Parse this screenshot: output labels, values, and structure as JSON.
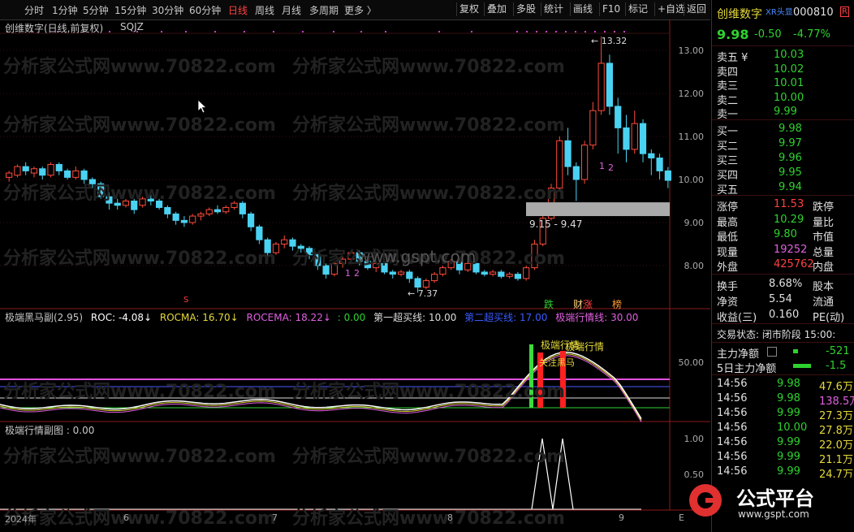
{
  "toolbar": {
    "periods": [
      "分时",
      "1分钟",
      "5分钟",
      "15分钟",
      "30分钟",
      "60分钟",
      "日线",
      "周线",
      "月线",
      "多周期",
      "更多 〉"
    ],
    "active_period": "日线",
    "buttons": [
      "复权",
      "叠加",
      "多股",
      "统计",
      "画线",
      "F10",
      "标记",
      "+自选",
      "返回"
    ]
  },
  "chart": {
    "title": "创维数字(日线,前复权)",
    "indicator": "SQJZ",
    "price_ticks": [
      "13.00",
      "12.00",
      "11.00",
      "10.00",
      "9.00",
      "8.00"
    ],
    "high_label": "13.32",
    "low_label": "7.37",
    "range_label": "9.15 - 9.47",
    "markers": [
      "跌",
      "财",
      "涨",
      "榜"
    ],
    "s_marker": "S",
    "num_labels": [
      "1",
      "2",
      "1",
      "2"
    ],
    "sub1": {
      "name": "极端黑马副(2.95)",
      "roc": "ROC: -4.08",
      "rocma": "ROCMA: 16.70",
      "rocema": "ROCEMA: 18.22",
      "zero": ": 0.00",
      "line1": "第一超买线: 10.00",
      "line2": "第二超买线: 17.00",
      "line3": "极端行情线: 30.00",
      "tick": "50.00",
      "annot1": "极端行情",
      "annot2": "极端行情",
      "annot3": "关注黑马"
    },
    "sub2": {
      "name": "极端行情副图 : 0.00",
      "ticks": [
        "1.00",
        "0.50"
      ]
    },
    "dates": [
      "2024年",
      "6",
      "7",
      "8",
      "9"
    ],
    "date_tail": "E"
  },
  "watermark": "分析家公式网www.70822.com",
  "quote": {
    "name": "创维数字",
    "tag": "XR头显",
    "code": "000810",
    "r_badge": "R",
    "price": "9.98",
    "change": "-0.50",
    "pct": "-4.77%",
    "asks": [
      {
        "label": "卖五 ¥",
        "price": "10.03"
      },
      {
        "label": "卖四",
        "price": "10.02"
      },
      {
        "label": "卖三",
        "price": "10.01"
      },
      {
        "label": "卖二",
        "price": "10.00"
      },
      {
        "label": "卖一",
        "price": "9.99"
      }
    ],
    "bids": [
      {
        "label": "买一",
        "price": "9.98"
      },
      {
        "label": "买二",
        "price": "9.97"
      },
      {
        "label": "买三",
        "price": "9.96"
      },
      {
        "label": "买四",
        "price": "9.95"
      },
      {
        "label": "买五",
        "price": "9.94"
      }
    ],
    "stats": [
      {
        "l": "涨停",
        "v": "11.53",
        "r": "跌停"
      },
      {
        "l": "最高",
        "v": "10.29",
        "r": "量比"
      },
      {
        "l": "最低",
        "v": "9.80",
        "r": "市值"
      },
      {
        "l": "现量",
        "v": "19252",
        "r": "总量"
      },
      {
        "l": "外盘",
        "v": "425762",
        "r": "内盘"
      }
    ],
    "stats2": [
      {
        "l": "换手",
        "v": "8.68%",
        "r": "股本"
      },
      {
        "l": "净资",
        "v": "5.54",
        "r": "流通"
      },
      {
        "l": "收益(三)",
        "v": "0.160",
        "r": "PE(动)"
      }
    ],
    "trade_status": "交易状态: 闭市阶段 15:00:",
    "flow": [
      {
        "l": "主力净额",
        "v": "-521"
      },
      {
        "l": "5日主力净额",
        "v": "-1.5"
      }
    ],
    "ticks": [
      {
        "t": "14:56",
        "p": "9.98",
        "v": "47.6万"
      },
      {
        "t": "14:56",
        "p": "9.98",
        "v": "138.5万"
      },
      {
        "t": "14:56",
        "p": "9.99",
        "v": "27.3万"
      },
      {
        "t": "14:56",
        "p": "10.00",
        "v": "27.8万"
      },
      {
        "t": "14:56",
        "p": "9.99",
        "v": "22.0万"
      },
      {
        "t": "14:56",
        "p": "9.99",
        "v": "21.1万"
      },
      {
        "t": "14:56",
        "p": "9.99",
        "v": "24.7万"
      }
    ],
    "logo_text": "公式平台",
    "logo_url": "www.gspt.com"
  },
  "center_watermark": "www.gspt.com"
}
